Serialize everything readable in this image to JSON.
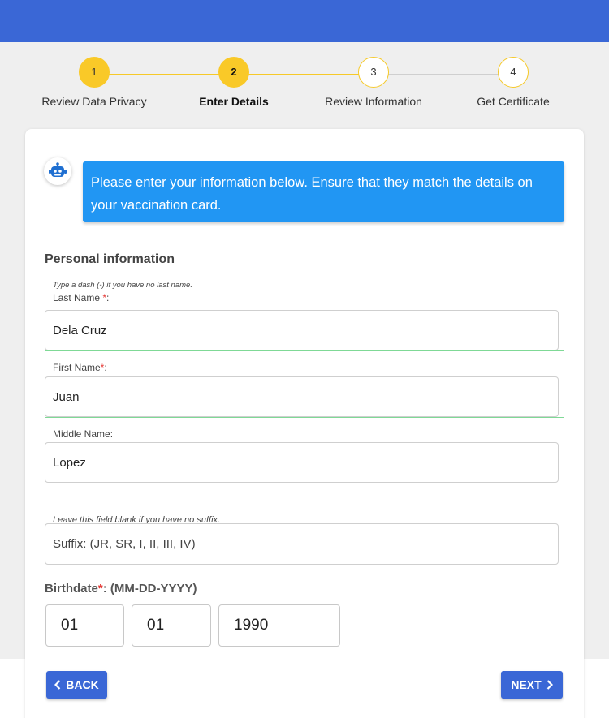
{
  "stepper": {
    "steps": [
      {
        "number": "1",
        "label": "Review Data Privacy",
        "state": "done"
      },
      {
        "number": "2",
        "label": "Enter Details",
        "state": "active"
      },
      {
        "number": "3",
        "label": "Review Information",
        "state": "pending"
      },
      {
        "number": "4",
        "label": "Get Certificate",
        "state": "pending"
      }
    ]
  },
  "bot": {
    "icon": "robot-icon",
    "message": "Please enter your information below. Ensure that they match the details on your vaccination card."
  },
  "form": {
    "section_title": "Personal information",
    "last_name": {
      "hint": "Type a dash (-) if you have no last name.",
      "label": "Last Name ",
      "required_mark": "*",
      "label_suffix": ":",
      "value": "Dela Cruz"
    },
    "first_name": {
      "label": "First Name",
      "required_mark": "*",
      "label_suffix": ":",
      "value": "Juan"
    },
    "middle_name": {
      "label": "Middle Name:",
      "value": "Lopez"
    },
    "suffix": {
      "hint": "Leave this field blank if you have no suffix.",
      "placeholder": "Suffix: (JR, SR, I, II, III, IV)",
      "value": ""
    },
    "birthdate": {
      "label": "Birthdate",
      "required_mark": "*",
      "label_suffix": ": (MM-DD-YYYY)",
      "month": "01",
      "day": "01",
      "year": "1990"
    }
  },
  "actions": {
    "back_label": "BACK",
    "next_label": "NEXT"
  },
  "colors": {
    "header": "#3a67d6",
    "step_active": "#f9c928",
    "bubble": "#2196f3",
    "button": "#3a67d6",
    "required": "#e53935"
  }
}
